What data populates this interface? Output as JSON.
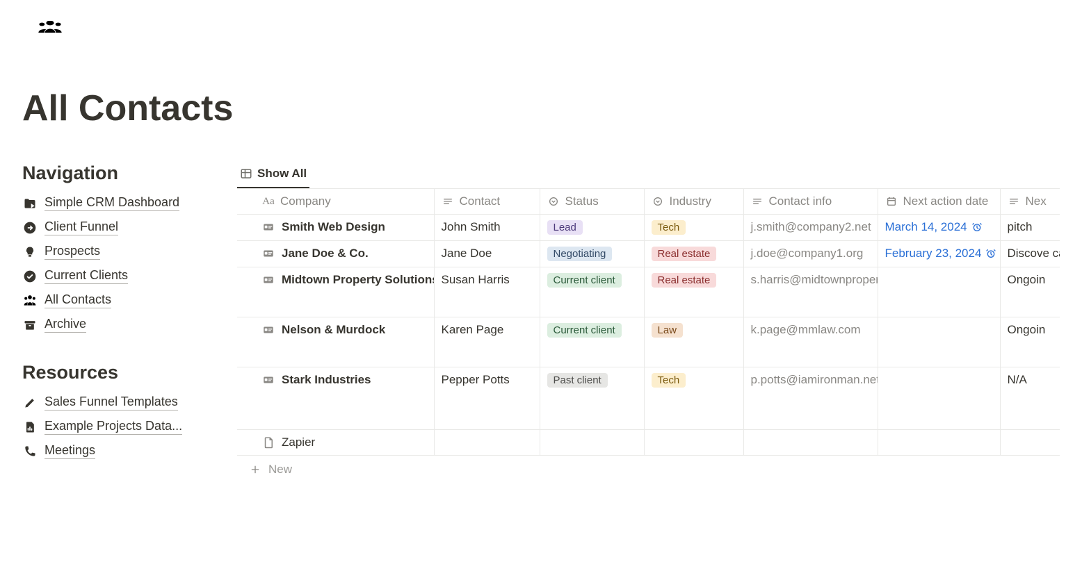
{
  "page": {
    "title": "All Contacts"
  },
  "sidebar": {
    "navigation_label": "Navigation",
    "nav": [
      {
        "label": "Simple CRM Dashboard",
        "icon": "folder-shortcut"
      },
      {
        "label": "Client Funnel",
        "icon": "arrow-circle"
      },
      {
        "label": "Prospects",
        "icon": "bulb"
      },
      {
        "label": "Current Clients",
        "icon": "check-circle"
      },
      {
        "label": "All Contacts",
        "icon": "people"
      },
      {
        "label": "Archive",
        "icon": "archive-box"
      }
    ],
    "resources_label": "Resources",
    "resources": [
      {
        "label": "Sales Funnel Templates",
        "icon": "pencil"
      },
      {
        "label": "Example Projects Data...",
        "icon": "file-chart"
      },
      {
        "label": "Meetings",
        "icon": "phone"
      }
    ]
  },
  "tabs": {
    "show_all": "Show All"
  },
  "columns": {
    "company": "Company",
    "contact": "Contact",
    "status": "Status",
    "industry": "Industry",
    "contact_info": "Contact info",
    "next_action_date": "Next action date",
    "next": "Nex"
  },
  "statusColors": {
    "Lead": {
      "bg": "#e8e0f5",
      "fg": "#4d3a7b"
    },
    "Negotiating": {
      "bg": "#dde7f1",
      "fg": "#334a66"
    },
    "Current client": {
      "bg": "#dceee0",
      "fg": "#2b5a3a"
    },
    "Past client": {
      "bg": "#e6e6e4",
      "fg": "#4d4d4b"
    }
  },
  "industryColors": {
    "Tech": {
      "bg": "#fceecd",
      "fg": "#7a5a0e"
    },
    "Real estate": {
      "bg": "#f8dada",
      "fg": "#8a2e2e"
    },
    "Law": {
      "bg": "#f5e1cf",
      "fg": "#7a4a1b"
    }
  },
  "rows": [
    {
      "company": "Smith Web Design",
      "contact": "John Smith",
      "status": "Lead",
      "industry": "Tech",
      "info": "j.smith@company2.net",
      "date": "March 14, 2024",
      "alarm": true,
      "next": "pitch",
      "h": ""
    },
    {
      "company": "Jane Doe & Co.",
      "contact": "Jane Doe",
      "status": "Negotiating",
      "industry": "Real estate",
      "info": "j.doe@company1.org",
      "date": "February 23, 2024",
      "alarm": true,
      "next": "Discove call you",
      "h": ""
    },
    {
      "company": "Midtown Property Solutions",
      "contact": "Susan Harris",
      "status": "Current client",
      "industry": "Real estate",
      "info": "s.harris@midtownproperty.",
      "date": "",
      "alarm": false,
      "next": "Ongoin",
      "h": "rowpad"
    },
    {
      "company": "Nelson & Murdock",
      "contact": "Karen Page",
      "status": "Current client",
      "industry": "Law",
      "info": "k.page@mmlaw.com",
      "date": "",
      "alarm": false,
      "next": "Ongoin",
      "h": "rowpad"
    },
    {
      "company": "Stark Industries",
      "contact": "Pepper Potts",
      "status": "Past client",
      "industry": "Tech",
      "info": "p.potts@iamironman.net",
      "date": "",
      "alarm": false,
      "next": "N/A",
      "h": "rowpad3"
    }
  ],
  "pageRow": {
    "company": "Zapier"
  },
  "newRow": {
    "label": "New"
  }
}
